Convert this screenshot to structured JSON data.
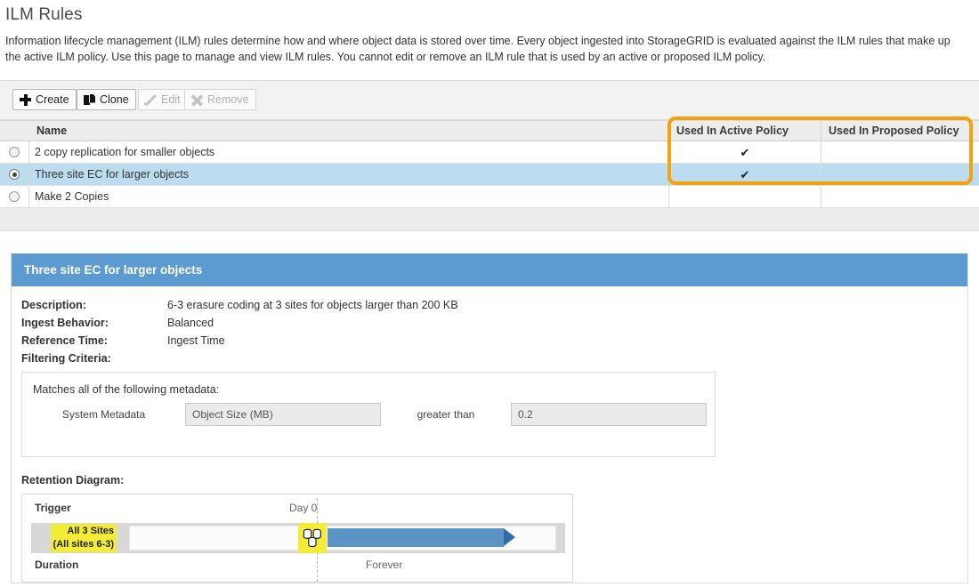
{
  "page": {
    "title": "ILM Rules",
    "description": "Information lifecycle management (ILM) rules determine how and where object data is stored over time. Every object ingested into StorageGRID is evaluated against the ILM rules that make up the active ILM policy. Use this page to manage and view ILM rules. You cannot edit or remove an ILM rule that is used by an active or proposed ILM policy."
  },
  "toolbar": {
    "create_label": "Create",
    "clone_label": "Clone",
    "edit_label": "Edit",
    "remove_label": "Remove",
    "create_icon": "plus-icon",
    "clone_icon": "copy-icon",
    "edit_icon": "pencil-icon",
    "remove_icon": "x-icon"
  },
  "table": {
    "columns": [
      "Name",
      "Used In Active Policy",
      "Used In Proposed Policy"
    ],
    "rows": [
      {
        "name": "2 copy replication for smaller objects",
        "active": "✔",
        "proposed": "",
        "selected": false
      },
      {
        "name": "Three site EC for larger objects",
        "active": "✔",
        "proposed": "",
        "selected": true
      },
      {
        "name": "Make 2 Copies",
        "active": "",
        "proposed": "",
        "selected": false
      }
    ]
  },
  "highlight": {
    "color": "#f2a20c",
    "covers": "Used In Active Policy and Used In Proposed Policy columns"
  },
  "detail": {
    "header": "Three site EC for larger objects",
    "header_color": "#5b9bd1",
    "fields": [
      {
        "label": "Description:",
        "value": "6-3 erasure coding at 3 sites for objects larger than 200 KB"
      },
      {
        "label": "Ingest Behavior:",
        "value": "Balanced"
      },
      {
        "label": "Reference Time:",
        "value": "Ingest Time"
      },
      {
        "label": "Filtering Criteria:",
        "value": ""
      }
    ],
    "filter": {
      "title": "Matches all of the following metadata:",
      "criteria_label": "System Metadata",
      "metadata_value": "Object Size (MB)",
      "operator": "greater than",
      "value": "0.2"
    },
    "retention": {
      "label": "Retention Diagram:",
      "trigger_label": "Trigger",
      "trigger_time": "Day 0",
      "placement_line1": "All 3 Sites",
      "placement_line2": "(All sites 6-3)",
      "duration_label": "Duration",
      "duration_value": "Forever",
      "highlight_color": "#f2ec38",
      "bar_color": "#5b94c4",
      "storage_icon": "disk-stack-icon"
    }
  }
}
